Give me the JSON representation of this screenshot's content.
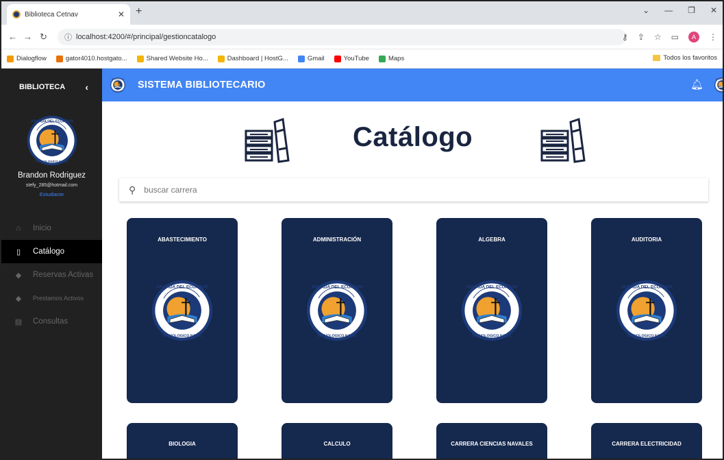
{
  "browser": {
    "tab_title": "Biblioteca Cetnav",
    "url": "localhost:4200/#/principal/gestioncatalogo",
    "profile_initial": "A",
    "bookmarks": [
      {
        "label": "Dialogflow",
        "color": "#f29900"
      },
      {
        "label": "gator4010.hostgato...",
        "color": "#e8710a"
      },
      {
        "label": "Shared Website Ho...",
        "color": "#f4b400"
      },
      {
        "label": "Dashboard | HostG...",
        "color": "#f4b400"
      },
      {
        "label": "Gmail",
        "color": "#4285f4"
      },
      {
        "label": "YouTube",
        "color": "#ff0000"
      },
      {
        "label": "Maps",
        "color": "#34a853"
      }
    ],
    "bookmarks_folder": "Todos los favoritos"
  },
  "sidebar": {
    "title": "BIBLIOTECA",
    "user_name": "Brandon Rodriguez",
    "user_email": "stefy_285@hotmail.com",
    "user_role": "Estudiante",
    "items": [
      {
        "label": "Inicio",
        "icon": "home-icon"
      },
      {
        "label": "Catálogo",
        "icon": "book-icon"
      },
      {
        "label": "Reservas Activas",
        "icon": "tag-icon"
      },
      {
        "label": "Prestamos Activos",
        "icon": "tag-icon"
      },
      {
        "label": "Consultas",
        "icon": "document-icon"
      }
    ]
  },
  "topbar": {
    "title": "SISTEMA BIBLIOTECARIO"
  },
  "page": {
    "heading": "Catálogo",
    "search_placeholder": "buscar carrera"
  },
  "cards": [
    {
      "label": "ABASTECIMIENTO"
    },
    {
      "label": "ADMINISTRACIÓN"
    },
    {
      "label": "ALGEBRA"
    },
    {
      "label": "AUDITORIA"
    },
    {
      "label": "BIOLOGIA"
    },
    {
      "label": "CALCULO"
    },
    {
      "label": "CARRERA CIENCIAS NAVALES"
    },
    {
      "label": "CARRERA ELECTRICIDAD"
    }
  ],
  "colors": {
    "accent": "#4285f4",
    "card_bg": "#15284d",
    "sidebar_bg": "#212121"
  }
}
